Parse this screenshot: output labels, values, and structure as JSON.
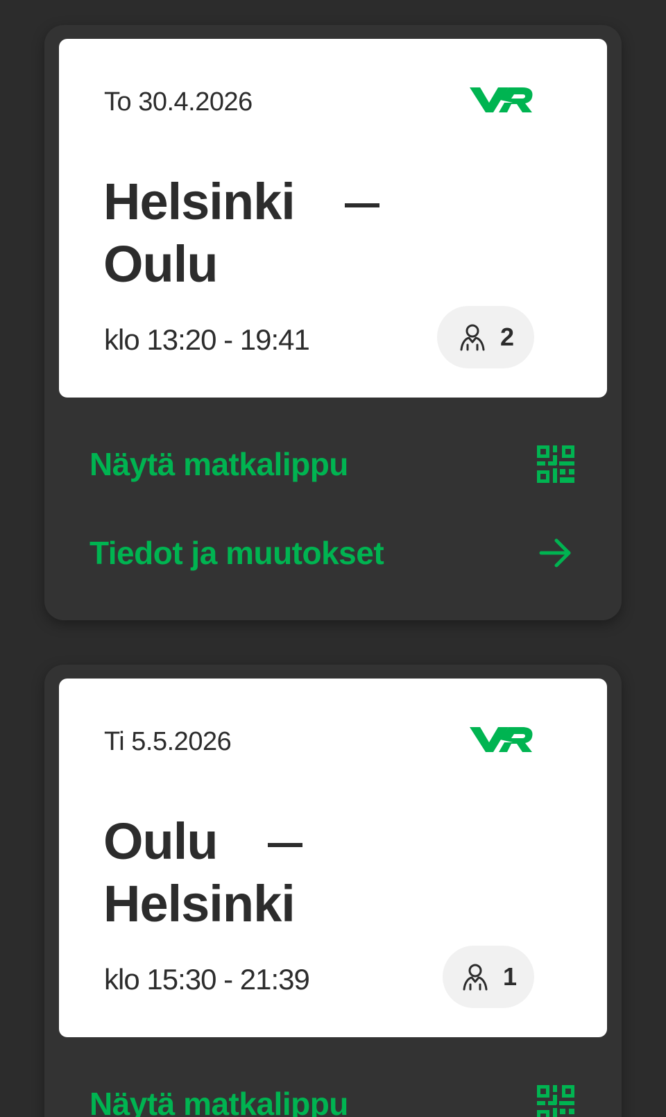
{
  "colors": {
    "background": "#2c2c2c",
    "card": "#333333",
    "ticket": "#ffffff",
    "accent": "#00b451",
    "text": "#2c2c2c"
  },
  "trips": [
    {
      "date": "To 30.4.2026",
      "logo": "VR",
      "from": "Helsinki",
      "to": "Oulu",
      "time": "klo 13:20 - 19:41",
      "passengers": "2",
      "passenger_icon": "person-icon",
      "show_ticket_label": "Näytä matkalippu",
      "show_ticket_icon": "qr-code-icon",
      "details_label": "Tiedot ja muutokset",
      "details_icon": "arrow-right-icon"
    },
    {
      "date": "Ti 5.5.2026",
      "logo": "VR",
      "from": "Oulu",
      "to": "Helsinki",
      "time": "klo 15:30 - 21:39",
      "passengers": "1",
      "passenger_icon": "person-icon",
      "show_ticket_label": "Näytä matkalippu",
      "show_ticket_icon": "qr-code-icon"
    }
  ]
}
